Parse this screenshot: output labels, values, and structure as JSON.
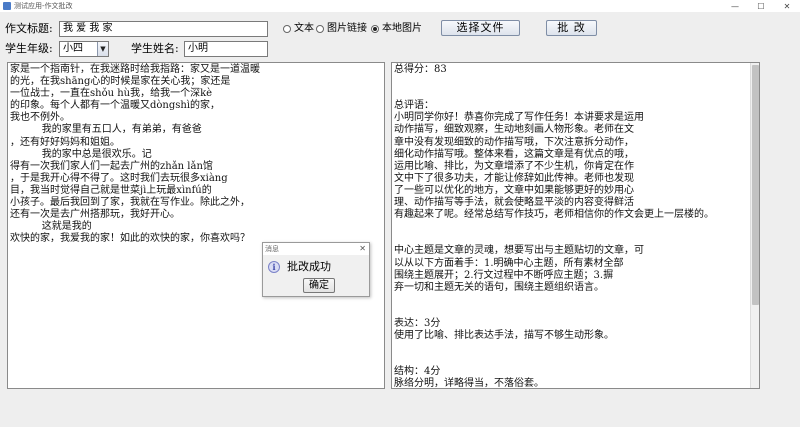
{
  "window": {
    "title": "测试应用-作文批改",
    "controls": {
      "minimize": "—",
      "maximize": "☐",
      "close": "✕"
    }
  },
  "form": {
    "title_label": "作文标题:",
    "title_value": "我 爱 我 家",
    "grade_label": "学生年级:",
    "grade_value": "小四",
    "name_label": "学生姓名:",
    "name_value": "小明"
  },
  "radios": [
    {
      "label": "文本",
      "selected": false
    },
    {
      "label": "图片链接",
      "selected": false
    },
    {
      "label": "本地图片",
      "selected": true
    }
  ],
  "buttons": {
    "choose_file": "选择文件",
    "grade": "批 改"
  },
  "essay_text": "家是一个指南针，在我迷路时给我指路：家又是一道温暖\n的光，在我shāng心的时候是家在关心我；家还是\n一位战士，一直在shǒu hù我，给我一个深kè\n的印象。每个人都有一个温暖又dòngshì的家，\n我也不例外。\n          我的家里有五口人，有弟弟，有爸爸\n，还有好好妈妈和姐姐。\n          我的家中总是很欢乐。记\n得有一次我们家人们一起去广州的zhǎn lǎn馆\n，于是我开心得不得了。这时我们去玩很多xiàng\n目，我当时觉得自己就是世菜jì上玩最xìnfú的\n小孩子。最后我回到了家，我就在写作业。除此之外，\n还有一次是去广州搭那玩，我好开心。\n          这就是我的\n欢快的家，我爱我的家！如此的欢快的家，你喜欢吗？",
  "feedback_text": "总得分：83\n\n\n总评语：\n小明同学你好！恭喜你完成了写作任务！本讲要求是运用\n动作描写，细致观察，生动地刻画人物形象。老师在文\n章中没有发现细致的动作描写哦，下次注意拆分动作，\n细化动作描写哦。整体来看，这篇文章是有优点的哦，\n运用比喻、排比，为文章增添了不少生机，你肯定在作\n文中下了很多功夫，才能让修辞如此传神。老师也发现\n了一些可以优化的地方，文章中如果能够更好的妙用心\n理、动作描写等手法，就会使略显平淡的内容变得鲜活\n有趣起来了呢。经常总结写作技巧，老师相信你的作文会更上一层楼的。\n\n\n中心主题是文章的灵魂，想要写出与主题贴切的文章，可\n以从以下方面着手：1.明确中心主题，所有素材全部\n围绕主题展开；2.行文过程中不断呼应主题；3.摒\n弃一切和主题无关的语句，围绕主题组织语言。\n\n\n表达：3分\n使用了比喻、排比表达手法，描写不够生动形象。\n\n\n结构：4分\n脉络分明，详略得当，不落俗套。",
  "dialog": {
    "title": "消息",
    "icon": "info-icon",
    "message": "批改成功",
    "ok_label": "确定",
    "close": "✕"
  }
}
